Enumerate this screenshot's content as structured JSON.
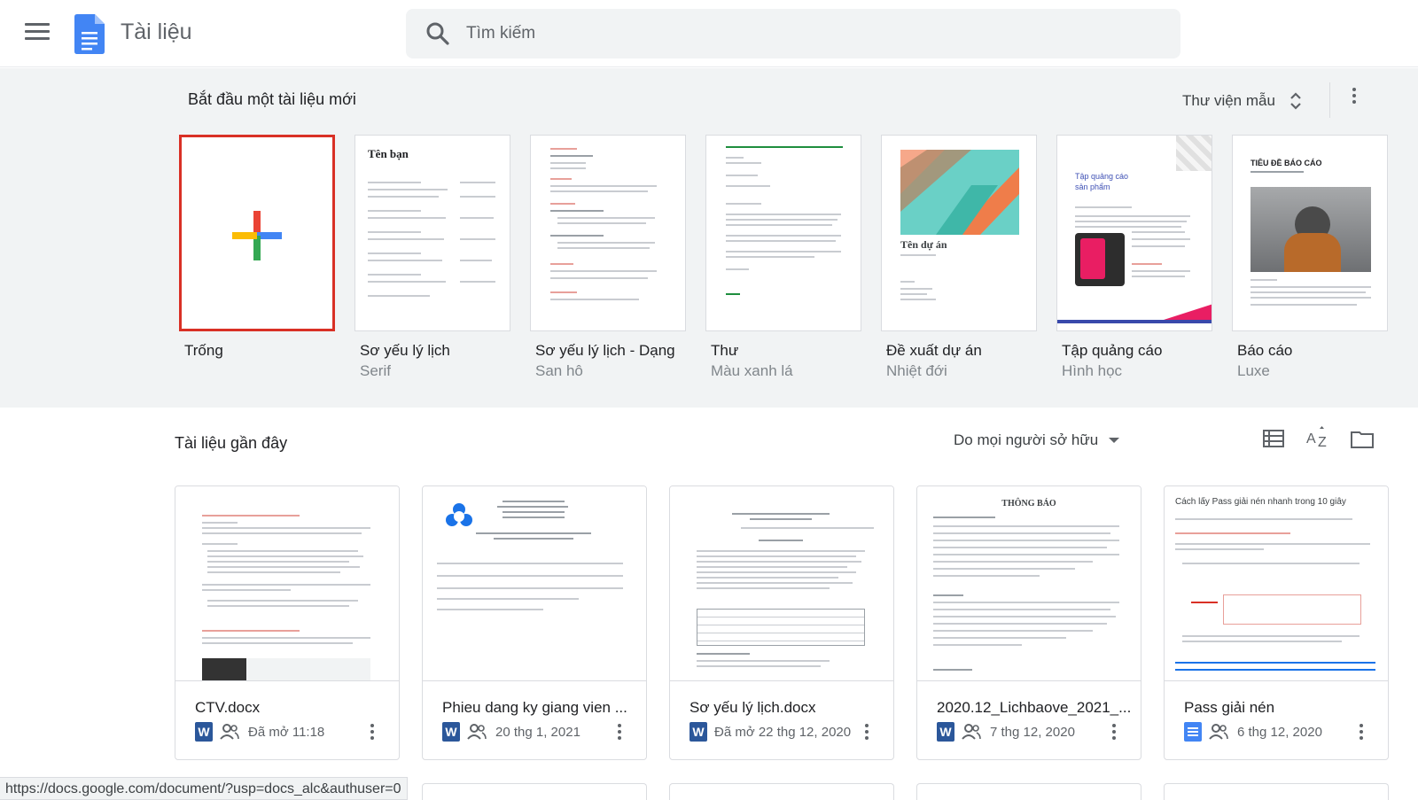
{
  "header": {
    "app_title": "Tài liệu",
    "search_placeholder": "Tìm kiếm"
  },
  "templates": {
    "section_title": "Bắt đầu một tài liệu mới",
    "gallery_label": "Thư viện mẫu",
    "items": [
      {
        "name": "Trống",
        "sub": ""
      },
      {
        "name": "Sơ yếu lý lịch",
        "sub": "Serif",
        "thumb_heading": "Tên bạn"
      },
      {
        "name": "Sơ yếu lý lịch - Dạng",
        "sub": "San hô"
      },
      {
        "name": "Thư",
        "sub": "Màu xanh lá"
      },
      {
        "name": "Đề xuất dự án",
        "sub": "Nhiệt đới",
        "thumb_heading": "Tên dự án"
      },
      {
        "name": "Tập quảng cáo",
        "sub": "Hình học",
        "thumb_heading": "Tập quảng cáo sản phẩm"
      },
      {
        "name": "Báo cáo",
        "sub": "Luxe",
        "thumb_heading": "TIÊU ĐỀ BÁO CÁO"
      }
    ]
  },
  "recent": {
    "title": "Tài liệu gần đây",
    "owner_filter": "Do mọi người sở hữu",
    "docs": [
      {
        "title": "CTV.docx",
        "type": "word",
        "meta": "Đã mở 11:18"
      },
      {
        "title": "Phieu dang ky giang vien ...",
        "type": "word",
        "meta": "20 thg 1, 2021"
      },
      {
        "title": "Sơ yếu lý lịch.docx",
        "type": "word",
        "meta": "Đã mở 22 thg 12, 2020"
      },
      {
        "title": "2020.12_Lichbaove_2021_...",
        "type": "word",
        "meta": "7 thg 12, 2020"
      },
      {
        "title": "Pass giải nén",
        "type": "gdoc",
        "meta": "6 thg 12, 2020"
      }
    ],
    "thumb_headings": {
      "doc4": "THÔNG BÁO",
      "doc5": "Cách lấy Pass giải nén nhanh trong 10 giây"
    }
  },
  "status_url": "https://docs.google.com/document/?usp=docs_alc&authuser=0",
  "colors": {
    "accent_blue": "#4285f4",
    "selected_red": "#d93025",
    "word_blue": "#2b579a"
  }
}
